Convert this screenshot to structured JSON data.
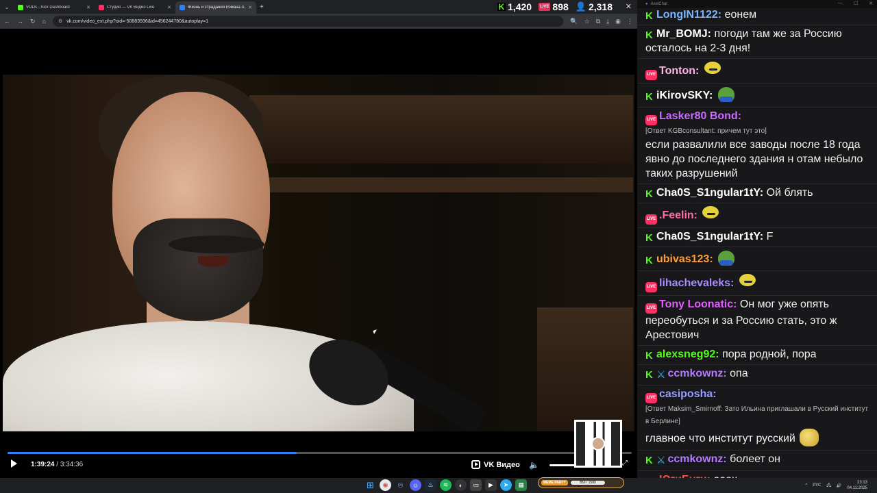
{
  "browser": {
    "tabs": [
      {
        "title": "VODs - Kick Dashboard",
        "color": "#53fc18"
      },
      {
        "title": "Студия — VK Видео Live",
        "color": "#ff2e63"
      },
      {
        "title": "Жизнь и страдания Романа А...",
        "color": "#2d81f7"
      }
    ],
    "url": "vk.com/video_ext.php?oid=-50883936&id=456244780&autoplay=1",
    "stats": {
      "kick": "1,420",
      "vk": "898",
      "viewers": "2,318"
    }
  },
  "player": {
    "current_time": "1:39:24",
    "separator": "/",
    "duration": "3:34:36",
    "progress": 0.463,
    "brand": "VK Видео",
    "volume": 1.0
  },
  "chat": {
    "window_title": "AxelChat",
    "messages": [
      {
        "platform": "kick",
        "name": "LongIN1122:",
        "color": "#7ab6ff",
        "text": "еонем"
      },
      {
        "platform": "kick",
        "name": "Mr_BOMJ:",
        "color": "#ffffff",
        "text": "погоди там же за Россию осталось на 2-3 дня!"
      },
      {
        "platform": "vk",
        "name": "Tonton:",
        "color": "#ffb5e8",
        "text": "",
        "emote": "blob"
      },
      {
        "platform": "kick",
        "name": "iKirovSKY:",
        "color": "#ffffff",
        "text": "",
        "emote": "pepe"
      },
      {
        "platform": "vk",
        "name": "Lasker80 Bond:",
        "color": "#c96bff",
        "reply": "[Ответ KGBconsultant: причем тут это]",
        "text": "если развалили все заводы после 18 года явно до последнего здания н отам небыло таких разрушений"
      },
      {
        "platform": "kick",
        "name": "Cha0S_S1ngular1tY:",
        "color": "#ffffff",
        "text": "Ой блять"
      },
      {
        "platform": "vk",
        "name": ".Feelin:",
        "color": "#ff6fa5",
        "text": "",
        "emote": "blob"
      },
      {
        "platform": "kick",
        "name": "Cha0S_S1ngular1tY:",
        "color": "#ffffff",
        "text": "F"
      },
      {
        "platform": "kick",
        "name": "ubivas123:",
        "color": "#ff9f3a",
        "text": "",
        "emote": "pepe"
      },
      {
        "platform": "vk",
        "name": "lihachevaleks:",
        "color": "#a88bff",
        "text": "",
        "emote": "blob"
      },
      {
        "platform": "vk",
        "name": "Tony Loonatic:",
        "color": "#e05cff",
        "text": "Он мог уже опять переобуться и за Россию стать, это ж Арестович"
      },
      {
        "platform": "kick",
        "name": "alexsneg92:",
        "color": "#53fc18",
        "text": "пора родной, пора"
      },
      {
        "platform": "kick-mod",
        "name": "ccmkownz:",
        "color": "#b37bff",
        "text": "опа"
      },
      {
        "platform": "vk",
        "name": "casiposha:",
        "color": "#9a9cff",
        "reply": "[Ответ Maksim_Smirnoff: Зато Ильина приглашали в Русский институт в Берлине]",
        "text": "главное что институт русский",
        "emote": "coin"
      },
      {
        "platform": "kick-mod",
        "name": "ccmkownz:",
        "color": "#b37bff",
        "text": "болеет он"
      },
      {
        "platform": "vk",
        "name": "ЮгиБуги:",
        "color": "#ff4d4d",
        "text": "ааах"
      }
    ]
  },
  "taskbar": {
    "meme_tag": "MEME PARTY",
    "meme_progress": "850 / 1500",
    "lang": "РУС",
    "time": "23:13",
    "date": "04.11.2025"
  }
}
